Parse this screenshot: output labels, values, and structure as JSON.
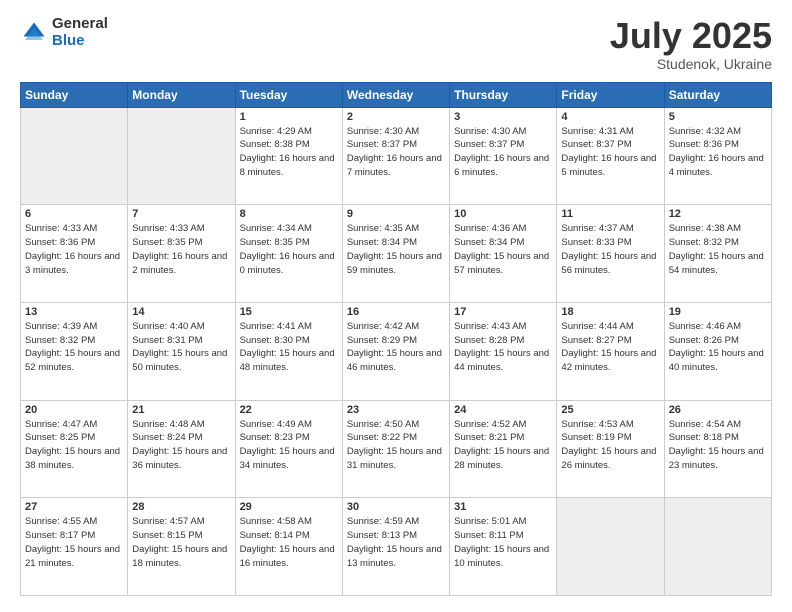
{
  "logo": {
    "general": "General",
    "blue": "Blue"
  },
  "title": "July 2025",
  "location": "Studenok, Ukraine",
  "weekdays": [
    "Sunday",
    "Monday",
    "Tuesday",
    "Wednesday",
    "Thursday",
    "Friday",
    "Saturday"
  ],
  "weeks": [
    [
      {
        "day": "",
        "empty": true
      },
      {
        "day": "",
        "empty": true
      },
      {
        "day": "1",
        "sunrise": "Sunrise: 4:29 AM",
        "sunset": "Sunset: 8:38 PM",
        "daylight": "Daylight: 16 hours and 8 minutes."
      },
      {
        "day": "2",
        "sunrise": "Sunrise: 4:30 AM",
        "sunset": "Sunset: 8:37 PM",
        "daylight": "Daylight: 16 hours and 7 minutes."
      },
      {
        "day": "3",
        "sunrise": "Sunrise: 4:30 AM",
        "sunset": "Sunset: 8:37 PM",
        "daylight": "Daylight: 16 hours and 6 minutes."
      },
      {
        "day": "4",
        "sunrise": "Sunrise: 4:31 AM",
        "sunset": "Sunset: 8:37 PM",
        "daylight": "Daylight: 16 hours and 5 minutes."
      },
      {
        "day": "5",
        "sunrise": "Sunrise: 4:32 AM",
        "sunset": "Sunset: 8:36 PM",
        "daylight": "Daylight: 16 hours and 4 minutes."
      }
    ],
    [
      {
        "day": "6",
        "sunrise": "Sunrise: 4:33 AM",
        "sunset": "Sunset: 8:36 PM",
        "daylight": "Daylight: 16 hours and 3 minutes."
      },
      {
        "day": "7",
        "sunrise": "Sunrise: 4:33 AM",
        "sunset": "Sunset: 8:35 PM",
        "daylight": "Daylight: 16 hours and 2 minutes."
      },
      {
        "day": "8",
        "sunrise": "Sunrise: 4:34 AM",
        "sunset": "Sunset: 8:35 PM",
        "daylight": "Daylight: 16 hours and 0 minutes."
      },
      {
        "day": "9",
        "sunrise": "Sunrise: 4:35 AM",
        "sunset": "Sunset: 8:34 PM",
        "daylight": "Daylight: 15 hours and 59 minutes."
      },
      {
        "day": "10",
        "sunrise": "Sunrise: 4:36 AM",
        "sunset": "Sunset: 8:34 PM",
        "daylight": "Daylight: 15 hours and 57 minutes."
      },
      {
        "day": "11",
        "sunrise": "Sunrise: 4:37 AM",
        "sunset": "Sunset: 8:33 PM",
        "daylight": "Daylight: 15 hours and 56 minutes."
      },
      {
        "day": "12",
        "sunrise": "Sunrise: 4:38 AM",
        "sunset": "Sunset: 8:32 PM",
        "daylight": "Daylight: 15 hours and 54 minutes."
      }
    ],
    [
      {
        "day": "13",
        "sunrise": "Sunrise: 4:39 AM",
        "sunset": "Sunset: 8:32 PM",
        "daylight": "Daylight: 15 hours and 52 minutes."
      },
      {
        "day": "14",
        "sunrise": "Sunrise: 4:40 AM",
        "sunset": "Sunset: 8:31 PM",
        "daylight": "Daylight: 15 hours and 50 minutes."
      },
      {
        "day": "15",
        "sunrise": "Sunrise: 4:41 AM",
        "sunset": "Sunset: 8:30 PM",
        "daylight": "Daylight: 15 hours and 48 minutes."
      },
      {
        "day": "16",
        "sunrise": "Sunrise: 4:42 AM",
        "sunset": "Sunset: 8:29 PM",
        "daylight": "Daylight: 15 hours and 46 minutes."
      },
      {
        "day": "17",
        "sunrise": "Sunrise: 4:43 AM",
        "sunset": "Sunset: 8:28 PM",
        "daylight": "Daylight: 15 hours and 44 minutes."
      },
      {
        "day": "18",
        "sunrise": "Sunrise: 4:44 AM",
        "sunset": "Sunset: 8:27 PM",
        "daylight": "Daylight: 15 hours and 42 minutes."
      },
      {
        "day": "19",
        "sunrise": "Sunrise: 4:46 AM",
        "sunset": "Sunset: 8:26 PM",
        "daylight": "Daylight: 15 hours and 40 minutes."
      }
    ],
    [
      {
        "day": "20",
        "sunrise": "Sunrise: 4:47 AM",
        "sunset": "Sunset: 8:25 PM",
        "daylight": "Daylight: 15 hours and 38 minutes."
      },
      {
        "day": "21",
        "sunrise": "Sunrise: 4:48 AM",
        "sunset": "Sunset: 8:24 PM",
        "daylight": "Daylight: 15 hours and 36 minutes."
      },
      {
        "day": "22",
        "sunrise": "Sunrise: 4:49 AM",
        "sunset": "Sunset: 8:23 PM",
        "daylight": "Daylight: 15 hours and 34 minutes."
      },
      {
        "day": "23",
        "sunrise": "Sunrise: 4:50 AM",
        "sunset": "Sunset: 8:22 PM",
        "daylight": "Daylight: 15 hours and 31 minutes."
      },
      {
        "day": "24",
        "sunrise": "Sunrise: 4:52 AM",
        "sunset": "Sunset: 8:21 PM",
        "daylight": "Daylight: 15 hours and 28 minutes."
      },
      {
        "day": "25",
        "sunrise": "Sunrise: 4:53 AM",
        "sunset": "Sunset: 8:19 PM",
        "daylight": "Daylight: 15 hours and 26 minutes."
      },
      {
        "day": "26",
        "sunrise": "Sunrise: 4:54 AM",
        "sunset": "Sunset: 8:18 PM",
        "daylight": "Daylight: 15 hours and 23 minutes."
      }
    ],
    [
      {
        "day": "27",
        "sunrise": "Sunrise: 4:55 AM",
        "sunset": "Sunset: 8:17 PM",
        "daylight": "Daylight: 15 hours and 21 minutes."
      },
      {
        "day": "28",
        "sunrise": "Sunrise: 4:57 AM",
        "sunset": "Sunset: 8:15 PM",
        "daylight": "Daylight: 15 hours and 18 minutes."
      },
      {
        "day": "29",
        "sunrise": "Sunrise: 4:58 AM",
        "sunset": "Sunset: 8:14 PM",
        "daylight": "Daylight: 15 hours and 16 minutes."
      },
      {
        "day": "30",
        "sunrise": "Sunrise: 4:59 AM",
        "sunset": "Sunset: 8:13 PM",
        "daylight": "Daylight: 15 hours and 13 minutes."
      },
      {
        "day": "31",
        "sunrise": "Sunrise: 5:01 AM",
        "sunset": "Sunset: 8:11 PM",
        "daylight": "Daylight: 15 hours and 10 minutes."
      },
      {
        "day": "",
        "empty": true
      },
      {
        "day": "",
        "empty": true
      }
    ]
  ]
}
